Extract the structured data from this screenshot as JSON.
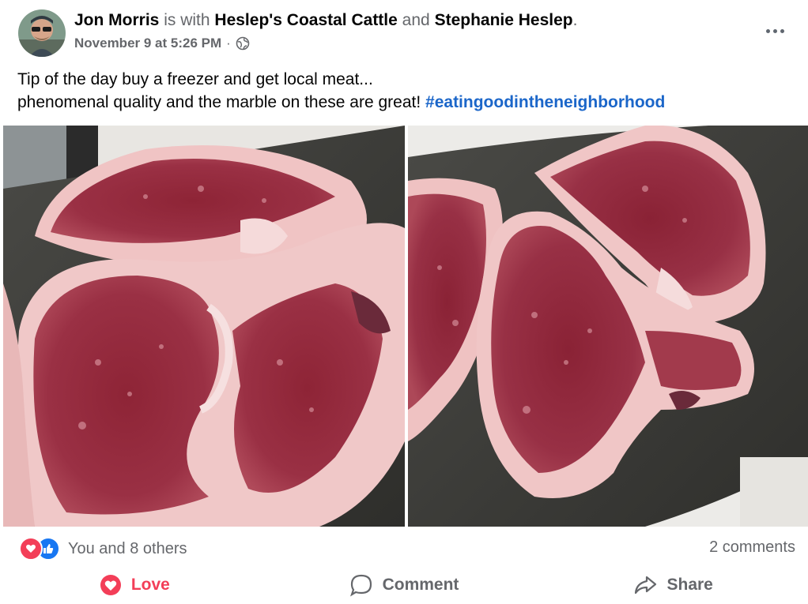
{
  "post": {
    "author": "Jon Morris",
    "with_text": "is with",
    "tagged_page": "Heslep's Coastal Cattle",
    "and_text": "and",
    "tagged_person": "Stephanie Heslep",
    "period": ".",
    "timestamp": "November 9 at 5:26 PM",
    "separator": "·",
    "audience_icon": "globe-icon",
    "more_icon": "more-options-icon",
    "text_line1": "Tip of the day buy a freezer and get local meat...",
    "text_line2": "phenomenal quality and the marble on these are great!",
    "hashtag": "#eatingoodintheneighborhood"
  },
  "photos": [
    {
      "description_icon": "steak-photo"
    },
    {
      "description_icon": "steak-photo"
    }
  ],
  "reactions": {
    "icons": [
      "love-reaction-icon",
      "like-reaction-icon"
    ],
    "summary": "You and 8 others",
    "comments": "2 comments"
  },
  "actions": {
    "love": "Love",
    "comment": "Comment",
    "share": "Share"
  },
  "colors": {
    "love": "#f33e58",
    "like": "#1877f2",
    "hashtag": "#1b66c9",
    "muted": "#65676b"
  }
}
